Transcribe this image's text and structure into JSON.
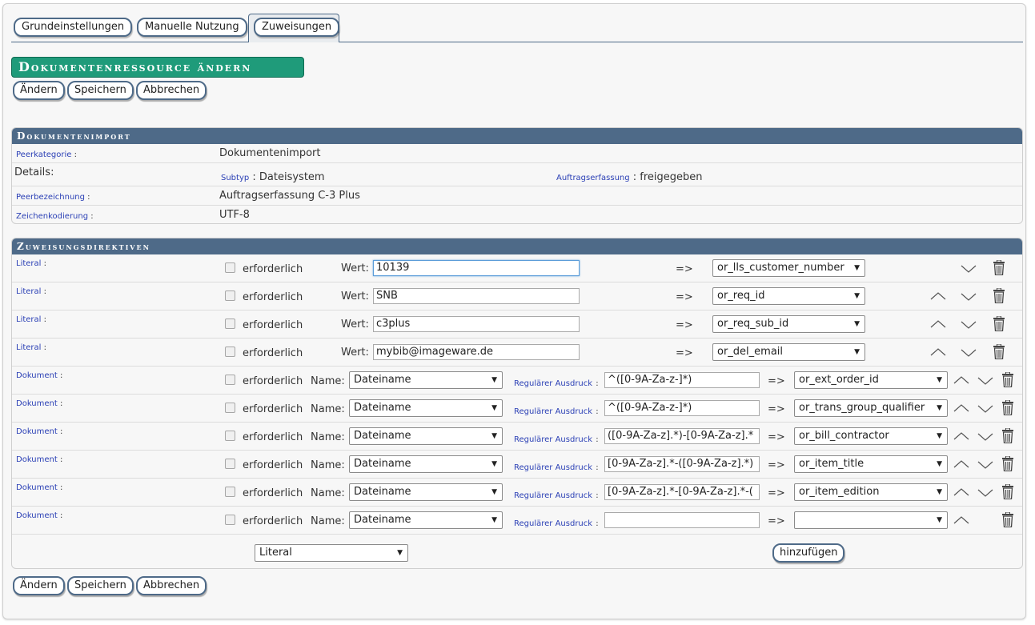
{
  "tabs": [
    {
      "label": "Grundeinstellungen"
    },
    {
      "label": "Manuelle Nutzung"
    },
    {
      "label": "Zuweisungen"
    }
  ],
  "page_title": "Dokumentenressource ändern",
  "actions": {
    "change": "Ändern",
    "save": "Speichern",
    "cancel": "Abbrechen"
  },
  "import_section": {
    "title": "Dokumentenimport",
    "peer_category_label": "Peerkategorie",
    "peer_category_value": "Dokumentenimport",
    "details_label": "Details:",
    "subtype_label": "Subtyp",
    "subtype_value": "Dateisystem",
    "order_label": "Auftragserfassung",
    "order_value": "freigegeben",
    "peer_name_label": "Peerbezeichnung",
    "peer_name_value": "Auftragserfassung C-3 Plus",
    "encoding_label": "Zeichenkodierung",
    "encoding_value": "UTF-8"
  },
  "directives": {
    "title": "Zuweisungsdirektiven",
    "colon": ":",
    "required_label": "erforderlich",
    "value_label": "Wert:",
    "name_label": "Name:",
    "regex_label": "Regulärer Ausdruck",
    "arrow": "=>",
    "rows": [
      {
        "type": "Literal",
        "value": "10139",
        "target": "or_lls_customer_number"
      },
      {
        "type": "Literal",
        "value": "SNB",
        "target": "or_req_id"
      },
      {
        "type": "Literal",
        "value": "c3plus",
        "target": "or_req_sub_id"
      },
      {
        "type": "Literal",
        "value": "mybib@imageware.de",
        "target": "or_del_email"
      },
      {
        "type": "Dokument",
        "name": "Dateiname",
        "regex": "^([0-9A-Za-z-]*)",
        "target": "or_ext_order_id"
      },
      {
        "type": "Dokument",
        "name": "Dateiname",
        "regex": "^([0-9A-Za-z-]*)",
        "target": "or_trans_group_qualifier"
      },
      {
        "type": "Dokument",
        "name": "Dateiname",
        "regex": "([0-9A-Za-z].*)-[0-9A-Za-z].*",
        "target": "or_bill_contractor"
      },
      {
        "type": "Dokument",
        "name": "Dateiname",
        "regex": "[0-9A-Za-z].*-([0-9A-Za-z].*)",
        "target": "or_item_title"
      },
      {
        "type": "Dokument",
        "name": "Dateiname",
        "regex": "[0-9A-Za-z].*-[0-9A-Za-z].*-(",
        "target": "or_item_edition"
      },
      {
        "type": "Dokument",
        "name": "Dateiname",
        "regex": "",
        "target": ""
      }
    ],
    "new_type": "Literal",
    "add_label": "hinzufügen"
  }
}
